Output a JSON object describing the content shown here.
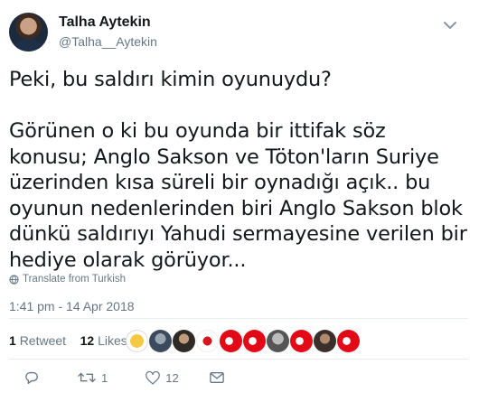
{
  "user": {
    "name": "Talha Aytekin",
    "handle": "@Talha__Aytekin"
  },
  "tweet": {
    "text": "Peki, bu saldırı kimin oyunuydu?\n\nGörünen o ki bu oyunda bir ittifak söz konusu; Anglo Sakson ve Töton'ların Suriye üzerinden kısa süreli bir oynadığı açık.. bu oyunun nedenlerinden biri Anglo Sakson blok dünkü saldırıyı Yahudi sermayesine verilen bir hediye olarak görüyor...",
    "translate_label": "Translate from Turkish",
    "timestamp": "1:41 pm - 14 Apr 2018"
  },
  "stats": {
    "retweets_count": "1",
    "retweets_label": "Retweet",
    "likes_count": "12",
    "likes_label": "Likes"
  },
  "actions": {
    "retweet_count": "1",
    "like_count": "12"
  },
  "colors": {
    "muted": "#657786",
    "separator": "#e6ecf0",
    "text": "#14171a"
  },
  "icons": [
    "chevron-down-icon",
    "globe-icon",
    "reply-icon",
    "retweet-icon",
    "like-icon",
    "message-icon"
  ]
}
